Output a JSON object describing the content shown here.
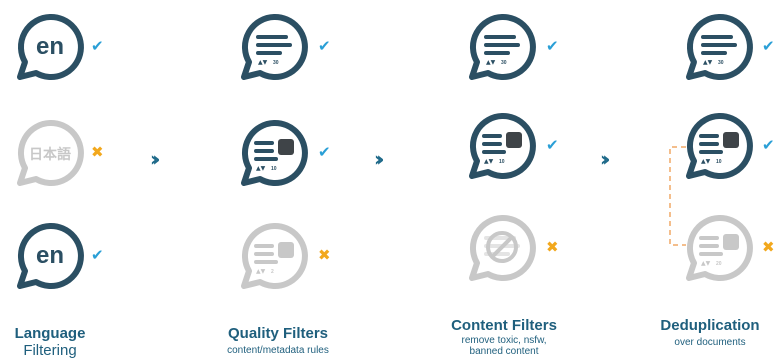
{
  "columns": [
    {
      "title": "Language",
      "subtitle": "Filtering",
      "items": [
        {
          "type": "text",
          "text": "en",
          "state": "ok"
        },
        {
          "type": "text",
          "text": "日本語",
          "state": "no"
        },
        {
          "type": "text",
          "text": "en",
          "state": "ok"
        }
      ]
    },
    {
      "title": "Quality Filters",
      "subtitle": "content/metadata rules",
      "items": [
        {
          "type": "lines",
          "score": "30",
          "state": "ok"
        },
        {
          "type": "lines-image",
          "score": "10",
          "state": "ok"
        },
        {
          "type": "lines-image",
          "score": "2",
          "state": "no"
        }
      ]
    },
    {
      "title": "Content Filters",
      "subtitle_lines": [
        "remove toxic, nsfw,",
        "banned content"
      ],
      "items": [
        {
          "type": "lines",
          "score": "30",
          "state": "ok"
        },
        {
          "type": "lines-image",
          "score": "10",
          "state": "ok"
        },
        {
          "type": "blocked",
          "state": "no"
        }
      ]
    },
    {
      "title": "Deduplication",
      "subtitle": "over documents",
      "items": [
        {
          "type": "lines",
          "score": "30",
          "state": "ok"
        },
        {
          "type": "lines-image",
          "score": "10",
          "state": "ok"
        },
        {
          "type": "lines-image",
          "score": "20",
          "state": "no"
        }
      ]
    }
  ],
  "marks": {
    "ok": "✔",
    "no": "✖"
  },
  "arrow_glyph": "››",
  "colors": {
    "active": "#2b4f63",
    "inactive": "#c8c8c8",
    "check": "#2a9fd6",
    "cross": "#f2a81d",
    "label": "#1f5f7d",
    "dedup_link": "#f0a866"
  }
}
